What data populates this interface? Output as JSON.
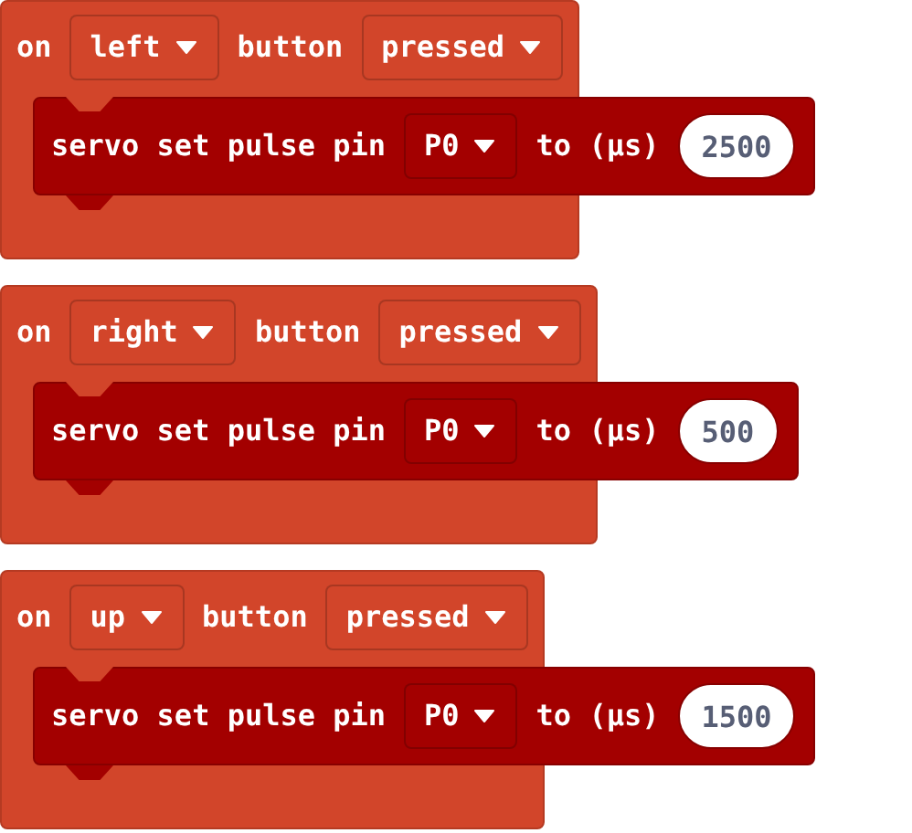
{
  "scripts": [
    {
      "header": [
        {
          "kind": "label",
          "text": "on"
        },
        {
          "kind": "dropdown",
          "text": "left"
        },
        {
          "kind": "label",
          "text": "button"
        },
        {
          "kind": "dropdown",
          "text": "pressed"
        }
      ],
      "statement": [
        {
          "kind": "label",
          "text": "servo set pulse pin"
        },
        {
          "kind": "dropdown",
          "text": "P0"
        },
        {
          "kind": "label",
          "text": "to (µs)"
        },
        {
          "kind": "number",
          "text": "2500"
        }
      ]
    },
    {
      "header": [
        {
          "kind": "label",
          "text": "on"
        },
        {
          "kind": "dropdown",
          "text": "right"
        },
        {
          "kind": "label",
          "text": "button"
        },
        {
          "kind": "dropdown",
          "text": "pressed"
        }
      ],
      "statement": [
        {
          "kind": "label",
          "text": "servo set pulse pin"
        },
        {
          "kind": "dropdown",
          "text": "P0"
        },
        {
          "kind": "label",
          "text": "to (µs)"
        },
        {
          "kind": "number",
          "text": "500"
        }
      ]
    },
    {
      "header": [
        {
          "kind": "label",
          "text": "on"
        },
        {
          "kind": "dropdown",
          "text": "up"
        },
        {
          "kind": "label",
          "text": "button"
        },
        {
          "kind": "dropdown",
          "text": "pressed"
        }
      ],
      "statement": [
        {
          "kind": "label",
          "text": "servo set pulse pin"
        },
        {
          "kind": "dropdown",
          "text": "P0"
        },
        {
          "kind": "label",
          "text": "to (µs)"
        },
        {
          "kind": "number",
          "text": "1500"
        }
      ]
    }
  ]
}
